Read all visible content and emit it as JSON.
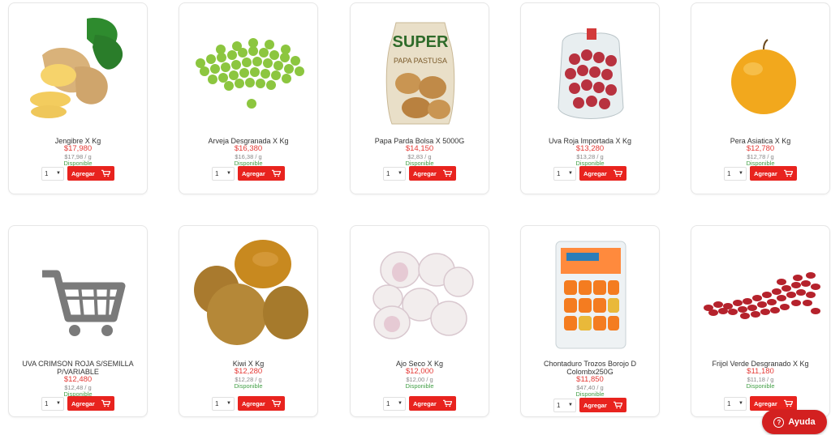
{
  "products": [
    {
      "name": "Jengibre X Kg",
      "price": "$17,980",
      "unit_price": "$17,98 / g",
      "availability": "Disponible",
      "qty": "1",
      "add_label": "Agregar",
      "image_icon": "ginger-image"
    },
    {
      "name": "Arveja Desgranada X Kg",
      "price": "$16,380",
      "unit_price": "$16,38 / g",
      "availability": "Disponible",
      "qty": "1",
      "add_label": "Agregar",
      "image_icon": "peas-image"
    },
    {
      "name": "Papa Parda Bolsa X 5000G",
      "price": "$14,150",
      "unit_price": "$2,83 / g",
      "availability": "Disponible",
      "qty": "1",
      "add_label": "Agregar",
      "image_icon": "potato-bag-image"
    },
    {
      "name": "Uva Roja Importada X Kg",
      "price": "$13,280",
      "unit_price": "$13,28 / g",
      "availability": "Disponible",
      "qty": "1",
      "add_label": "Agregar",
      "image_icon": "grapes-bag-image"
    },
    {
      "name": "Pera Asiatica X Kg",
      "price": "$12,780",
      "unit_price": "$12,78 / g",
      "availability": "Disponible",
      "qty": "1",
      "add_label": "Agregar",
      "image_icon": "asian-pear-image"
    },
    {
      "name": "UVA CRIMSON ROJA S/SEMILLA P/VARIABLE",
      "price": "$12,480",
      "unit_price": "$12,48 / g",
      "availability": "Disponible",
      "qty": "1",
      "add_label": "Agregar",
      "image_icon": "cart-placeholder-icon"
    },
    {
      "name": "Kiwi X Kg",
      "price": "$12,280",
      "unit_price": "$12,28 / g",
      "availability": "Disponible",
      "qty": "1",
      "add_label": "Agregar",
      "image_icon": "kiwi-image"
    },
    {
      "name": "Ajo Seco X Kg",
      "price": "$12,000",
      "unit_price": "$12,00 / g",
      "availability": "Disponible",
      "qty": "1",
      "add_label": "Agregar",
      "image_icon": "garlic-image"
    },
    {
      "name": "Chontaduro Trozos Borojo D Colombx250G",
      "price": "$11,850",
      "unit_price": "$47,40 / g",
      "availability": "Disponible",
      "qty": "1",
      "add_label": "Agregar",
      "image_icon": "chontaduro-pack-image"
    },
    {
      "name": "Frijol Verde Desgranado X Kg",
      "price": "$11,180",
      "unit_price": "$11,18 / g",
      "availability": "Disponible",
      "qty": "1",
      "add_label": "Agregar",
      "image_icon": "beans-image"
    }
  ],
  "help_button": {
    "label": "Ayuda",
    "icon": "question-circle-icon"
  },
  "colors": {
    "price": "#e53935",
    "available": "#43a047",
    "accent": "#e8231e",
    "help": "#d32020"
  }
}
